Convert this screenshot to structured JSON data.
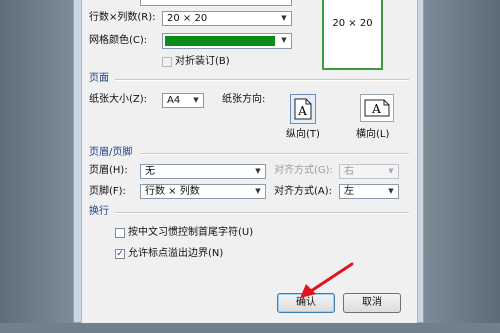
{
  "grid": {
    "rows_cols_label": "行数×列数(R):",
    "rows_cols_value": "20 × 20",
    "grid_color_label": "网格颜色(C):",
    "grid_color": "#0a8a16",
    "fold_binding_label": "对折装订(B)",
    "preview_text": "20 × 20"
  },
  "page": {
    "section_title": "页面",
    "paper_size_label": "纸张大小(Z):",
    "paper_size_value": "A4",
    "orientation_label": "纸张方向:",
    "portrait_label": "纵向(T)",
    "landscape_label": "横向(L)",
    "page_icon_letter": "A"
  },
  "header_footer": {
    "section_title": "页眉/页脚",
    "header_label": "页眉(H):",
    "header_value": "无",
    "header_align_label": "对齐方式(G):",
    "header_align_value": "右",
    "footer_label": "页脚(F):",
    "footer_value": "行数 × 列数",
    "footer_align_label": "对齐方式(A):",
    "footer_align_value": "左"
  },
  "line_break": {
    "section_title": "换行",
    "option1_label": "按中文习惯控制首尾字符(U)",
    "option1_checked": false,
    "option2_label": "允许标点溢出边界(N)",
    "option2_checked": true
  },
  "buttons": {
    "ok_label": "确认",
    "cancel_label": "取消"
  },
  "colors": {
    "section_title": "#1f3f8a",
    "annotation_arrow": "#e0141e",
    "default_button_border": "#3c7fb1"
  }
}
